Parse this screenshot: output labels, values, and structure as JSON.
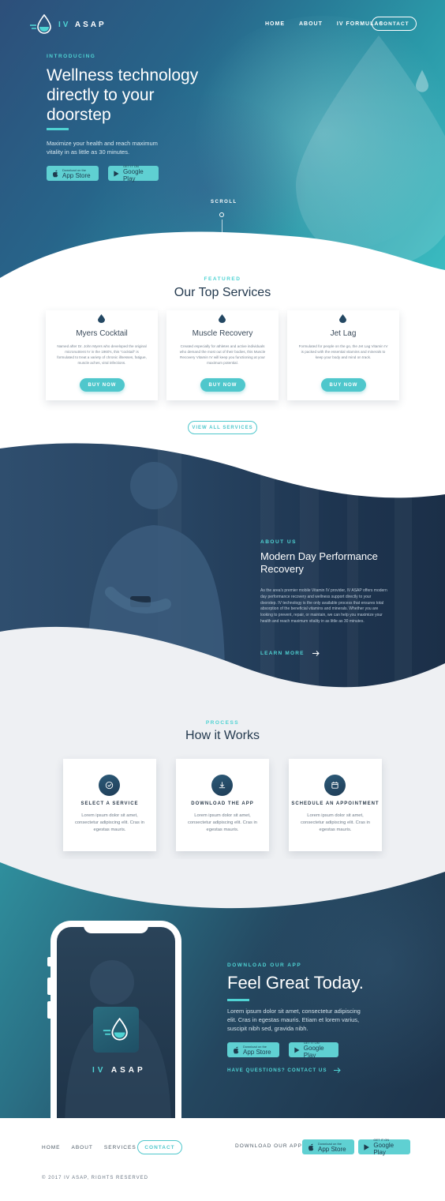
{
  "brand": {
    "prefix": "IV",
    "suffix": "ASAP"
  },
  "nav": {
    "items": [
      "HOME",
      "ABOUT",
      "IV FORMULAS"
    ],
    "contact": "CONTACT"
  },
  "hero": {
    "eyebrow": "INTRODUCING",
    "title": "Wellness technology directly to your doorstep",
    "subtitle": "Maximize your health and reach maximum vitality in as little as 30 minutes.",
    "scroll": "SCROLL"
  },
  "stores": {
    "apple_small": "Download on the",
    "apple_big": "App Store",
    "google_small": "GET IT ON",
    "google_big": "Google Play"
  },
  "services": {
    "eyebrow": "FEATURED",
    "title": "Our Top Services",
    "items": [
      {
        "name": "Myers Cocktail",
        "desc": "Named after Dr. John Myers who developed the original micronutrient IV in the 1960's, this \"cocktail\" is formulated to treat a variety of chronic illnesses, fatigue, muscle aches, viral infections.",
        "button": "BUY NOW"
      },
      {
        "name": "Muscle Recovery",
        "desc": "Created especially for athletes and active individuals who demand the most out of their bodies, this Muscle Recovery Vitamin IV will keep you functioning at your maximum potential.",
        "button": "BUY NOW"
      },
      {
        "name": "Jet Lag",
        "desc": "Formulated for people on the go, the Jet Lag Vitamin IV is packed with the essential vitamins and minerals to keep your body and mind on track.",
        "button": "BUY NOW"
      }
    ],
    "view_all": "VIEW ALL SERVICES"
  },
  "about": {
    "eyebrow": "ABOUT US",
    "title": "Modern Day Performance Recovery",
    "text": "As the area's premier mobile Vitamin IV provider, IV ASAP offers modern day performance recovery and wellness support directly to your doorstep. IV technology is the only available process that ensures total absorption of the beneficial vitamins and minerals. Whether you are looking to prevent, repair, or maintain, we can help you maximize your health and reach maximum vitality in as little as 30 minutes.",
    "link": "LEARN MORE"
  },
  "process": {
    "eyebrow": "PROCESS",
    "title": "How it Works",
    "steps": [
      {
        "title": "SELECT A SERVICE",
        "text": "Lorem ipsum dolor sit amet, consectetur adipiscing elit. Cras in egestas mauris.",
        "icon": "check-circle-icon"
      },
      {
        "title": "DOWNLOAD THE APP",
        "text": "Lorem ipsum dolor sit amet, consectetur adipiscing elit. Cras in egestas mauris.",
        "icon": "download-icon"
      },
      {
        "title": "SCHEDULE AN APPOINTMENT",
        "text": "Lorem ipsum dolor sit amet, consectetur adipiscing elit. Cras in egestas mauris.",
        "icon": "calendar-icon"
      }
    ]
  },
  "download": {
    "eyebrow": "DOWNLOAD OUR APP",
    "title": "Feel Great Today.",
    "text": "Lorem ipsum dolor sit amet, consectetur adipiscing elit. Cras in egestas mauris. Etiam et lorem varius, suscipit nibh sed, gravida nibh.",
    "link": "HAVE QUESTIONS? CONTACT US"
  },
  "footer": {
    "nav": [
      "HOME",
      "ABOUT",
      "SERVICES"
    ],
    "contact": "CONTACT",
    "download_label": "DOWNLOAD OUR APP",
    "copyright": "© 2017 IV ASAP, RIGHTS RESERVED"
  },
  "colors": {
    "accent": "#4fd3d3",
    "button": "#4fc7cc",
    "navy": "#1e3550",
    "process_bg": "#eef0f3"
  }
}
